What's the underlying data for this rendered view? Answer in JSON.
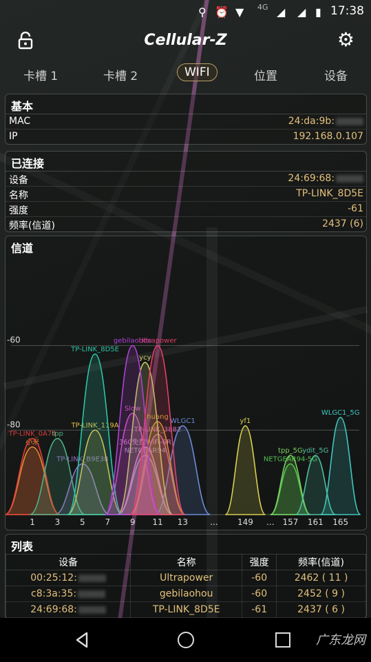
{
  "status_bar": {
    "time": "17:38",
    "network": "4G"
  },
  "app": {
    "title": "Cellular-Z"
  },
  "tabs": [
    {
      "label": "卡槽 1"
    },
    {
      "label": "卡槽 2"
    },
    {
      "label": "WIFI",
      "active": true
    },
    {
      "label": "位置"
    },
    {
      "label": "设备"
    }
  ],
  "basic": {
    "title": "基本",
    "mac_label": "MAC",
    "mac_value": "24:da:9b:",
    "ip_label": "IP",
    "ip_value": "192.168.0.107"
  },
  "connected": {
    "title": "已连接",
    "device_label": "设备",
    "device_value": "24:69:68:",
    "name_label": "名称",
    "name_value": "TP-LINK_8D5E",
    "strength_label": "强度",
    "strength_value": "-61",
    "freq_label": "频率(信道)",
    "freq_value": "2437 (6)"
  },
  "channel_section": {
    "title": "信道"
  },
  "chart_data": {
    "type": "area",
    "ylim": [
      -100,
      -40
    ],
    "yticks": [
      {
        "label": "-60",
        "value": -60
      },
      {
        "label": "-80",
        "value": -80
      }
    ],
    "xticks": [
      {
        "label": "1",
        "ch": 1
      },
      {
        "label": "3",
        "ch": 3
      },
      {
        "label": "5",
        "ch": 5
      },
      {
        "label": "7",
        "ch": 7
      },
      {
        "label": "9",
        "ch": 9
      },
      {
        "label": "11",
        "ch": 11
      },
      {
        "label": "13",
        "ch": 13
      },
      {
        "label": "...",
        "ch": 15.5
      },
      {
        "label": "149",
        "ch": 18
      },
      {
        "label": "...",
        "ch": 20
      },
      {
        "label": "157",
        "ch": 21.6
      },
      {
        "label": "161",
        "ch": 23.6
      },
      {
        "label": "165",
        "ch": 25.6
      }
    ],
    "series": [
      {
        "name": "TP-LINK_8D5E",
        "ch": 6,
        "rssi": -62,
        "color": "#2ec4a6"
      },
      {
        "name": "gebilaohou",
        "ch": 9,
        "rssi": -60,
        "color": "#b040d8"
      },
      {
        "name": "Ultrapower",
        "ch": 11,
        "rssi": -60,
        "color": "#e23f6a"
      },
      {
        "name": "ycy",
        "ch": 10,
        "rssi": -64,
        "color": "#c8d06a"
      },
      {
        "name": "TP-LINK_0A74",
        "ch": 1,
        "rssi": -82,
        "color": "#e03c3c"
      },
      {
        "name": "小米",
        "ch": 1,
        "rssi": -84,
        "color": "#e0a030"
      },
      {
        "name": "tpp",
        "ch": 3,
        "rssi": -82,
        "color": "#4fb08a"
      },
      {
        "name": "TP-LINK_119A",
        "ch": 6,
        "rssi": -80,
        "color": "#e6c04a"
      },
      {
        "name": "Slow",
        "ch": 9,
        "rssi": -76,
        "color": "#d050c0"
      },
      {
        "name": "huang",
        "ch": 11,
        "rssi": -78,
        "color": "#d0a030"
      },
      {
        "name": "WLGC1",
        "ch": 13,
        "rssi": -79,
        "color": "#6c8cd8"
      },
      {
        "name": "TP-LINK_3882",
        "ch": 11,
        "rssi": -81,
        "color": "#d06ab0"
      },
      {
        "name": "360免费WiFi-6R",
        "ch": 10,
        "rssi": -84,
        "color": "#d08ac8"
      },
      {
        "name": "NETGEAR94",
        "ch": 10,
        "rssi": -86,
        "color": "#a0a0c0"
      },
      {
        "name": "TP-LINK_B9E38",
        "ch": 5,
        "rssi": -88,
        "color": "#9070c0"
      },
      {
        "name": "yf1",
        "ch": 149,
        "rssi": -79,
        "color": "#d8d050"
      },
      {
        "name": "tpp_5G",
        "ch": 157,
        "rssi": -86,
        "color": "#7ad060"
      },
      {
        "name": "NETGEAR94-5G",
        "ch": 157,
        "rssi": -88,
        "color": "#50c050"
      },
      {
        "name": "ydit_5G",
        "ch": 161,
        "rssi": -86,
        "color": "#4fc0a0"
      },
      {
        "name": "WLGC1_5G",
        "ch": 165,
        "rssi": -77,
        "color": "#40c8c0"
      }
    ]
  },
  "list": {
    "title": "列表",
    "headers": [
      "设备",
      "名称",
      "强度",
      "频率(信道)"
    ],
    "rows": [
      [
        "00:25:12:",
        "Ultrapower",
        "-60",
        "2462 ( 11 )"
      ],
      [
        "c8:3a:35:",
        "gebilaohou",
        "-60",
        "2452 ( 9 )"
      ],
      [
        "24:69:68:",
        "TP-LINK_8D5E",
        "-61",
        "2437 ( 6 )"
      ]
    ]
  },
  "watermark": "广东龙网"
}
